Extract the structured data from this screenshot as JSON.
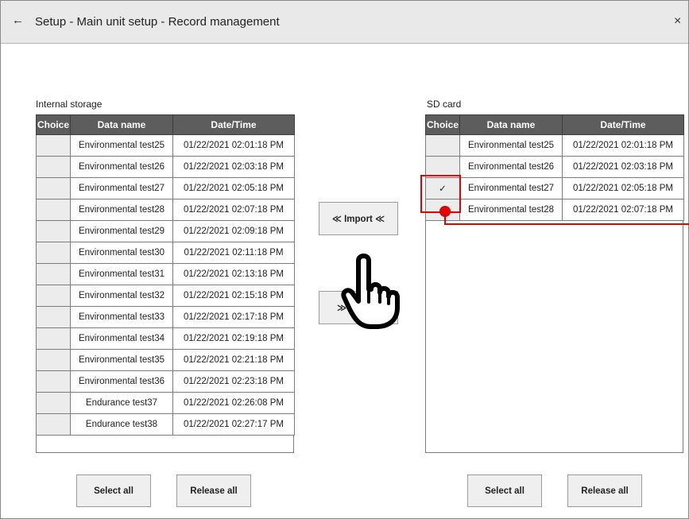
{
  "header": {
    "title": "Setup - Main unit setup - Record management",
    "back_icon": "←",
    "close_icon": "×"
  },
  "internal": {
    "caption": "Internal storage",
    "columns": [
      "Choice",
      "Data name",
      "Date/Time"
    ],
    "rows": [
      {
        "choice": "",
        "name": "Environmental test25",
        "datetime": "01/22/2021 02:01:18 PM"
      },
      {
        "choice": "",
        "name": "Environmental test26",
        "datetime": "01/22/2021 02:03:18 PM"
      },
      {
        "choice": "",
        "name": "Environmental test27",
        "datetime": "01/22/2021 02:05:18 PM"
      },
      {
        "choice": "",
        "name": "Environmental test28",
        "datetime": "01/22/2021 02:07:18 PM"
      },
      {
        "choice": "",
        "name": "Environmental test29",
        "datetime": "01/22/2021 02:09:18 PM"
      },
      {
        "choice": "",
        "name": "Environmental test30",
        "datetime": "01/22/2021 02:11:18 PM"
      },
      {
        "choice": "",
        "name": "Environmental test31",
        "datetime": "01/22/2021 02:13:18 PM"
      },
      {
        "choice": "",
        "name": "Environmental test32",
        "datetime": "01/22/2021 02:15:18 PM"
      },
      {
        "choice": "",
        "name": "Environmental test33",
        "datetime": "01/22/2021 02:17:18 PM"
      },
      {
        "choice": "",
        "name": "Environmental test34",
        "datetime": "01/22/2021 02:19:18 PM"
      },
      {
        "choice": "",
        "name": "Environmental test35",
        "datetime": "01/22/2021 02:21:18 PM"
      },
      {
        "choice": "",
        "name": "Environmental test36",
        "datetime": "01/22/2021 02:23:18 PM"
      },
      {
        "choice": "",
        "name": "Endurance test37",
        "datetime": "01/22/2021 02:26:08 PM"
      },
      {
        "choice": "",
        "name": "Endurance test38",
        "datetime": "01/22/2021 02:27:17 PM"
      }
    ],
    "select_all": "Select all",
    "release_all": "Release all"
  },
  "sd": {
    "caption": "SD card",
    "columns": [
      "Choice",
      "Data name",
      "Date/Time"
    ],
    "rows": [
      {
        "choice": "",
        "name": "Environmental test25",
        "datetime": "01/22/2021 02:01:18 PM"
      },
      {
        "choice": "",
        "name": "Environmental test26",
        "datetime": "01/22/2021 02:03:18 PM"
      },
      {
        "choice": "✓",
        "name": "Environmental test27",
        "datetime": "01/22/2021 02:05:18 PM"
      },
      {
        "choice": "",
        "name": "Environmental test28",
        "datetime": "01/22/2021 02:07:18 PM"
      }
    ],
    "select_all": "Select all",
    "release_all": "Release all"
  },
  "middle": {
    "import_label": "≪ Import ≪",
    "export_label": "≫"
  },
  "icons": {
    "pointer": "pointing-hand-icon"
  },
  "colors": {
    "header_bg": "#5d5d5d",
    "callout": "#e00000"
  }
}
